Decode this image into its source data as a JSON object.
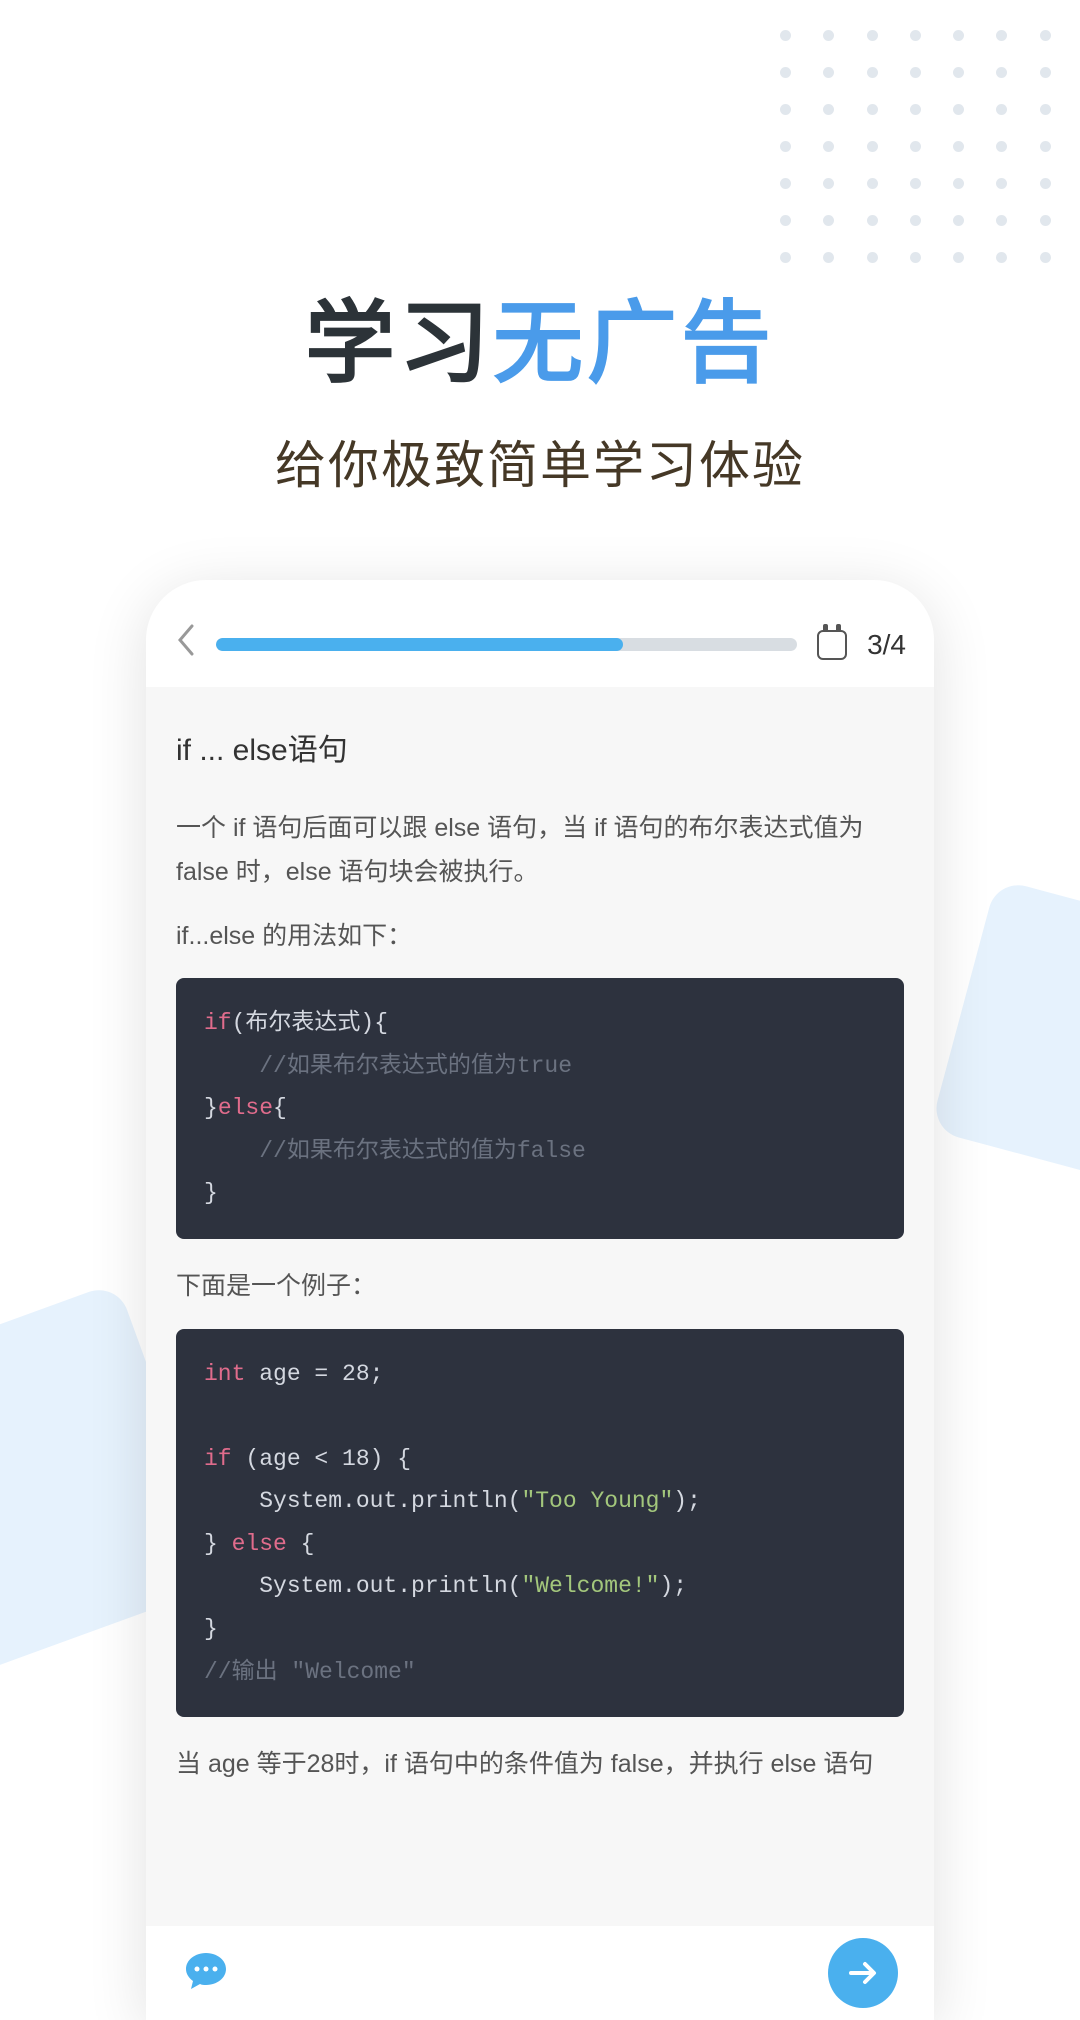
{
  "hero": {
    "title_part1": "学习",
    "title_part2": "无广告",
    "subtitle": "给你极致简单学习体验"
  },
  "topbar": {
    "counter": "3/4",
    "progress_percent": 70
  },
  "content": {
    "heading": "if ... else语句",
    "para1": "一个 if 语句后面可以跟 else 语句，当 if 语句的布尔表达式值为 false 时，else 语句块会被执行。",
    "para2": "if...else 的用法如下：",
    "para3": "下面是一个例子：",
    "para4": "当 age 等于28时，if 语句中的条件值为 false，并执行 else 语句"
  },
  "code1": {
    "l1a": "if",
    "l1b": "(布尔表达式){",
    "l2": "    //如果布尔表达式的值为true",
    "l3a": "}",
    "l3b": "else",
    "l3c": "{",
    "l4": "    //如果布尔表达式的值为false",
    "l5": "}"
  },
  "code2": {
    "l1a": "int",
    "l1b": " age = 28;",
    "l3a": "if",
    "l3b": " (age < 18) {",
    "l4a": "    System.out.println(",
    "l4b": "\"Too Young\"",
    "l4c": ");",
    "l5a": "} ",
    "l5b": "else",
    "l5c": " {",
    "l6a": "    System.out.println(",
    "l6b": "\"Welcome!\"",
    "l6c": ");",
    "l7": "}",
    "l8": "//输出 \"Welcome\""
  }
}
